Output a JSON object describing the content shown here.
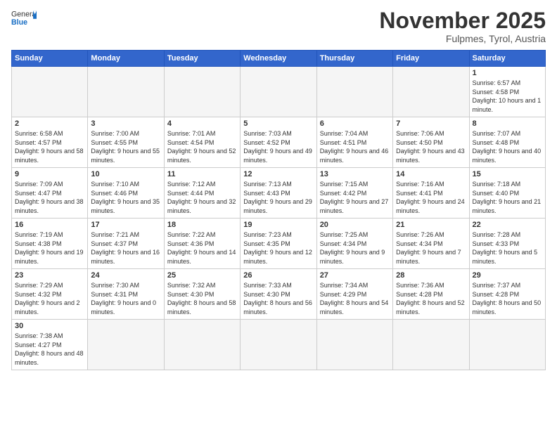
{
  "header": {
    "logo_general": "General",
    "logo_blue": "Blue",
    "month_title": "November 2025",
    "location": "Fulpmes, Tyrol, Austria"
  },
  "weekdays": [
    "Sunday",
    "Monday",
    "Tuesday",
    "Wednesday",
    "Thursday",
    "Friday",
    "Saturday"
  ],
  "weeks": [
    [
      {
        "day": "",
        "empty": true
      },
      {
        "day": "",
        "empty": true
      },
      {
        "day": "",
        "empty": true
      },
      {
        "day": "",
        "empty": true
      },
      {
        "day": "",
        "empty": true
      },
      {
        "day": "",
        "empty": true
      },
      {
        "day": "1",
        "sunrise": "6:57 AM",
        "sunset": "4:58 PM",
        "daylight": "10 hours and 1 minute."
      }
    ],
    [
      {
        "day": "2",
        "sunrise": "6:58 AM",
        "sunset": "4:57 PM",
        "daylight": "9 hours and 58 minutes."
      },
      {
        "day": "3",
        "sunrise": "7:00 AM",
        "sunset": "4:55 PM",
        "daylight": "9 hours and 55 minutes."
      },
      {
        "day": "4",
        "sunrise": "7:01 AM",
        "sunset": "4:54 PM",
        "daylight": "9 hours and 52 minutes."
      },
      {
        "day": "5",
        "sunrise": "7:03 AM",
        "sunset": "4:52 PM",
        "daylight": "9 hours and 49 minutes."
      },
      {
        "day": "6",
        "sunrise": "7:04 AM",
        "sunset": "4:51 PM",
        "daylight": "9 hours and 46 minutes."
      },
      {
        "day": "7",
        "sunrise": "7:06 AM",
        "sunset": "4:50 PM",
        "daylight": "9 hours and 43 minutes."
      },
      {
        "day": "8",
        "sunrise": "7:07 AM",
        "sunset": "4:48 PM",
        "daylight": "9 hours and 40 minutes."
      }
    ],
    [
      {
        "day": "9",
        "sunrise": "7:09 AM",
        "sunset": "4:47 PM",
        "daylight": "9 hours and 38 minutes."
      },
      {
        "day": "10",
        "sunrise": "7:10 AM",
        "sunset": "4:46 PM",
        "daylight": "9 hours and 35 minutes."
      },
      {
        "day": "11",
        "sunrise": "7:12 AM",
        "sunset": "4:44 PM",
        "daylight": "9 hours and 32 minutes."
      },
      {
        "day": "12",
        "sunrise": "7:13 AM",
        "sunset": "4:43 PM",
        "daylight": "9 hours and 29 minutes."
      },
      {
        "day": "13",
        "sunrise": "7:15 AM",
        "sunset": "4:42 PM",
        "daylight": "9 hours and 27 minutes."
      },
      {
        "day": "14",
        "sunrise": "7:16 AM",
        "sunset": "4:41 PM",
        "daylight": "9 hours and 24 minutes."
      },
      {
        "day": "15",
        "sunrise": "7:18 AM",
        "sunset": "4:40 PM",
        "daylight": "9 hours and 21 minutes."
      }
    ],
    [
      {
        "day": "16",
        "sunrise": "7:19 AM",
        "sunset": "4:38 PM",
        "daylight": "9 hours and 19 minutes."
      },
      {
        "day": "17",
        "sunrise": "7:21 AM",
        "sunset": "4:37 PM",
        "daylight": "9 hours and 16 minutes."
      },
      {
        "day": "18",
        "sunrise": "7:22 AM",
        "sunset": "4:36 PM",
        "daylight": "9 hours and 14 minutes."
      },
      {
        "day": "19",
        "sunrise": "7:23 AM",
        "sunset": "4:35 PM",
        "daylight": "9 hours and 12 minutes."
      },
      {
        "day": "20",
        "sunrise": "7:25 AM",
        "sunset": "4:34 PM",
        "daylight": "9 hours and 9 minutes."
      },
      {
        "day": "21",
        "sunrise": "7:26 AM",
        "sunset": "4:34 PM",
        "daylight": "9 hours and 7 minutes."
      },
      {
        "day": "22",
        "sunrise": "7:28 AM",
        "sunset": "4:33 PM",
        "daylight": "9 hours and 5 minutes."
      }
    ],
    [
      {
        "day": "23",
        "sunrise": "7:29 AM",
        "sunset": "4:32 PM",
        "daylight": "9 hours and 2 minutes."
      },
      {
        "day": "24",
        "sunrise": "7:30 AM",
        "sunset": "4:31 PM",
        "daylight": "9 hours and 0 minutes."
      },
      {
        "day": "25",
        "sunrise": "7:32 AM",
        "sunset": "4:30 PM",
        "daylight": "8 hours and 58 minutes."
      },
      {
        "day": "26",
        "sunrise": "7:33 AM",
        "sunset": "4:30 PM",
        "daylight": "8 hours and 56 minutes."
      },
      {
        "day": "27",
        "sunrise": "7:34 AM",
        "sunset": "4:29 PM",
        "daylight": "8 hours and 54 minutes."
      },
      {
        "day": "28",
        "sunrise": "7:36 AM",
        "sunset": "4:28 PM",
        "daylight": "8 hours and 52 minutes."
      },
      {
        "day": "29",
        "sunrise": "7:37 AM",
        "sunset": "4:28 PM",
        "daylight": "8 hours and 50 minutes."
      }
    ],
    [
      {
        "day": "30",
        "sunrise": "7:38 AM",
        "sunset": "4:27 PM",
        "daylight": "8 hours and 48 minutes."
      },
      {
        "day": "",
        "empty": true
      },
      {
        "day": "",
        "empty": true
      },
      {
        "day": "",
        "empty": true
      },
      {
        "day": "",
        "empty": true
      },
      {
        "day": "",
        "empty": true
      },
      {
        "day": "",
        "empty": true
      }
    ]
  ]
}
